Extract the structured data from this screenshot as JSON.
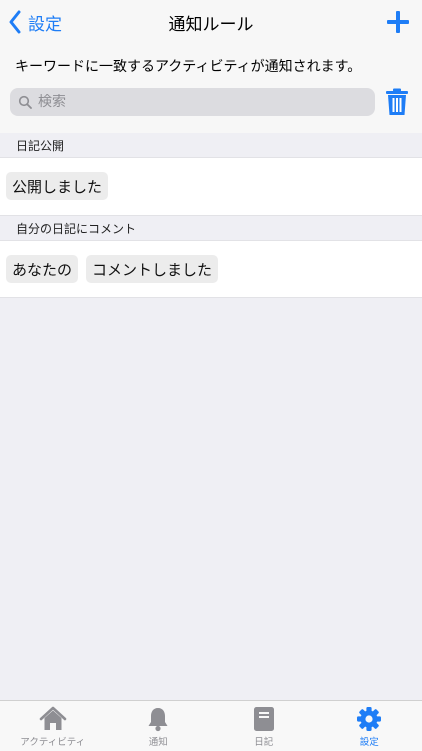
{
  "nav": {
    "back_label": "設定",
    "title": "通知ルール"
  },
  "header": {
    "description": "キーワードに一致するアクティビティが通知されます。",
    "search_placeholder": "検索"
  },
  "sections": [
    {
      "title": "日記公開",
      "keywords": [
        "公開しました"
      ]
    },
    {
      "title": "自分の日記にコメント",
      "keywords": [
        "あなたの",
        "コメントしました"
      ]
    }
  ],
  "tabs": [
    {
      "label": "アクティビティ",
      "icon": "home-icon",
      "active": false
    },
    {
      "label": "通知",
      "icon": "bell-icon",
      "active": false
    },
    {
      "label": "日記",
      "icon": "book-icon",
      "active": false
    },
    {
      "label": "設定",
      "icon": "gear-icon",
      "active": true
    }
  ],
  "colors": {
    "accent": "#1e7df6",
    "inactive": "#8e8e93",
    "background": "#efeff4"
  }
}
